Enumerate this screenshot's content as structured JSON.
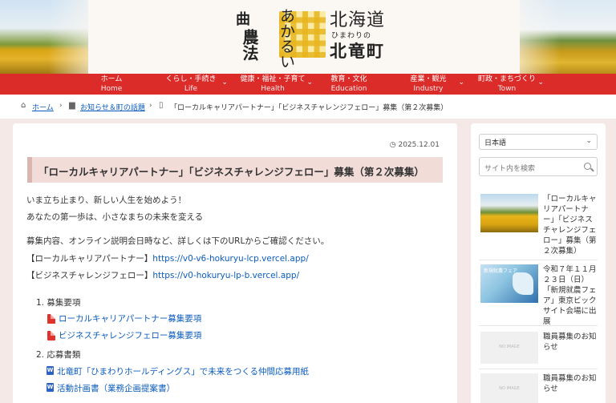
{
  "header": {
    "logo_kanji": "農法",
    "logo_kanji_top": "曲",
    "logo_akarui": "あかるい",
    "logo_hokkaido": "北海道",
    "logo_himawari": "ひまわりの",
    "logo_hokuryu": "北竜町"
  },
  "nav": {
    "items": [
      {
        "ja": "ホーム",
        "en": "Home"
      },
      {
        "ja": "くらし・手続き",
        "en": "Life"
      },
      {
        "ja": "健康・福祉・子育て",
        "en": "Health"
      },
      {
        "ja": "教育・文化",
        "en": "Education"
      },
      {
        "ja": "産業・観光",
        "en": "Industry"
      },
      {
        "ja": "町政・まちづくり",
        "en": "Town"
      }
    ]
  },
  "breadcrumb": {
    "home": "ホーム",
    "category": "お知らせ＆町の話題",
    "current": "「ローカルキャリアパートナー」「ビジネスチャレンジフェロー」募集（第２次募集）"
  },
  "article": {
    "date": "2025.12.01",
    "title": "「ローカルキャリアパートナー」「ビジネスチャレンジフェロー」募集（第２次募集）",
    "lead1": "いま立ち止まり、新しい人生を始めよう！",
    "lead2": "あなたの第一歩は、小さなまちの未来を変える",
    "intro": "募集内容、オンライン説明会日時など、詳しくは下のURLからご確認ください。",
    "link1_label": "【ローカルキャリアパートナー】",
    "link1_url": "https://v0-v6-hokuryu-lcp.vercel.app/",
    "link2_label": "【ビジネスチャレンジフェロー】",
    "link2_url": "https://v0-hokuryu-lp-b.vercel.app/",
    "section1": "1. 募集要項",
    "doc1": "ローカルキャリアパートナー募集要項",
    "doc2": "ビジネスチャレンジフェロー募集要項",
    "section2": "2. 応募書類",
    "doc3": "北竜町「ひまわりホールディングス」で未来をつくる仲間応募用紙",
    "doc4": "活動計画書（業務企画提案書）"
  },
  "sidebar": {
    "language": "日本語",
    "search_placeholder": "サイト内を検索",
    "noimage": "NO IMAGE",
    "fair_thumb_text": "新規就農フェア",
    "posts": [
      {
        "title": "「ローカルキャリアパートナー」「ビジネスチャレンジフェロー」募集（第２次募集）"
      },
      {
        "title": "令和７年１１月２３日（日）「新規就農フェア」東京ビックサイト会場に出展"
      },
      {
        "title": "職員募集のお知らせ"
      },
      {
        "title": "職員募集のお知らせ"
      }
    ]
  }
}
